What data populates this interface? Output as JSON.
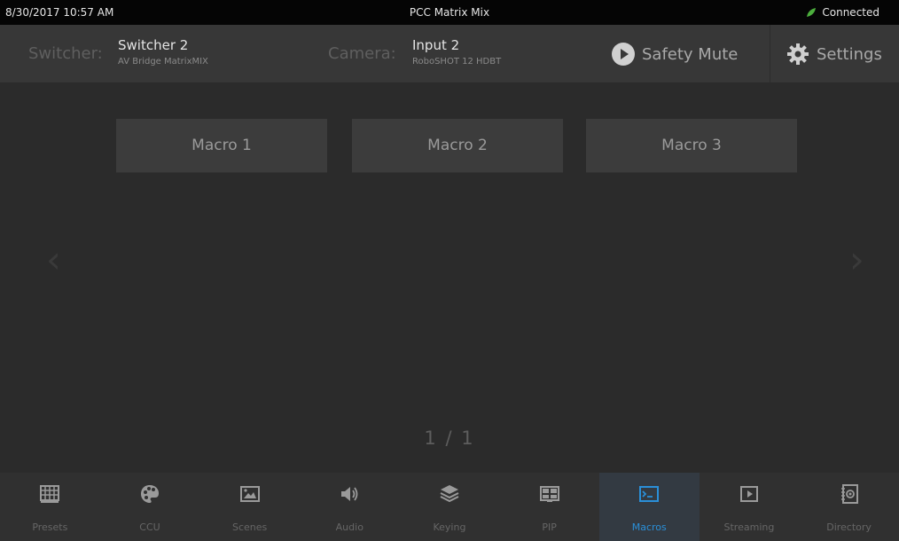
{
  "status": {
    "datetime": "8/30/2017 10:57 AM",
    "title": "PCC Matrix Mix",
    "connection": "Connected",
    "connection_color": "#4caf3d"
  },
  "header": {
    "switcher_label": "Switcher:",
    "switcher_name": "Switcher 2",
    "switcher_model": "AV Bridge MatrixMIX",
    "camera_label": "Camera:",
    "camera_name": "Input 2",
    "camera_model": "RoboSHOT 12 HDBT",
    "safety_mute_label": "Safety Mute",
    "settings_label": "Settings"
  },
  "macros": [
    {
      "label": "Macro 1"
    },
    {
      "label": "Macro 2"
    },
    {
      "label": "Macro 3"
    }
  ],
  "nav": {
    "prev": "‹",
    "next": "›"
  },
  "pager": "1 / 1",
  "tabs": [
    {
      "label": "Presets",
      "icon": "grid-icon"
    },
    {
      "label": "CCU",
      "icon": "palette-icon"
    },
    {
      "label": "Scenes",
      "icon": "scene-icon"
    },
    {
      "label": "Audio",
      "icon": "speaker-icon"
    },
    {
      "label": "Keying",
      "icon": "layers-icon"
    },
    {
      "label": "PIP",
      "icon": "pip-icon"
    },
    {
      "label": "Macros",
      "icon": "terminal-icon"
    },
    {
      "label": "Streaming",
      "icon": "stream-play-icon"
    },
    {
      "label": "Directory",
      "icon": "address-book-icon"
    }
  ],
  "active_tab": "Macros",
  "accent_color": "#2a8fd8"
}
